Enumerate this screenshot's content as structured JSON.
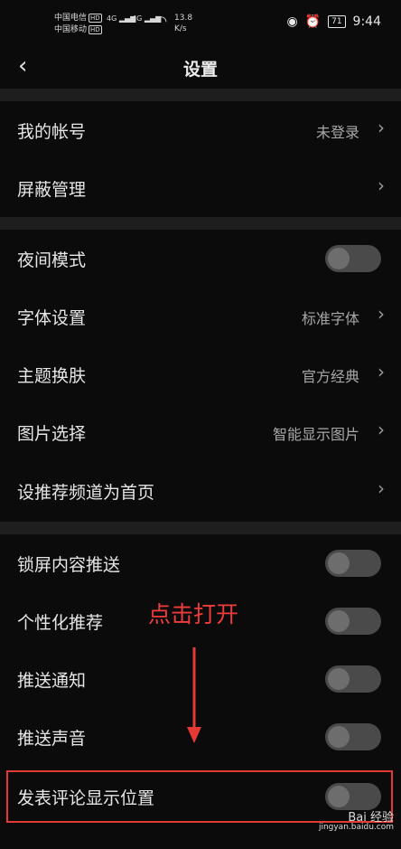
{
  "status": {
    "carrier1": "中国电信",
    "carrier2": "中国移动",
    "hd_badge": "HD",
    "net1": "4G",
    "net2": "4G",
    "speed_value": "13.8",
    "speed_unit": "K/s",
    "battery": "71",
    "time": "9:44"
  },
  "header": {
    "title": "设置"
  },
  "sections": [
    {
      "rows": [
        {
          "label": "我的帐号",
          "value": "未登录",
          "control": "chevron"
        },
        {
          "label": "屏蔽管理",
          "control": "chevron"
        }
      ]
    },
    {
      "rows": [
        {
          "label": "夜间模式",
          "control": "toggle",
          "toggle_on": false
        },
        {
          "label": "字体设置",
          "value": "标准字体",
          "control": "chevron"
        },
        {
          "label": "主题换肤",
          "value": "官方经典",
          "control": "chevron"
        },
        {
          "label": "图片选择",
          "value": "智能显示图片",
          "control": "chevron"
        },
        {
          "label": "设推荐频道为首页",
          "control": "chevron"
        }
      ]
    },
    {
      "rows": [
        {
          "label": "锁屏内容推送",
          "control": "toggle",
          "toggle_on": false
        },
        {
          "label": "个性化推荐",
          "control": "toggle",
          "toggle_on": false
        },
        {
          "label": "推送通知",
          "control": "toggle",
          "toggle_on": false
        },
        {
          "label": "推送声音",
          "control": "toggle",
          "toggle_on": false
        },
        {
          "label": "发表评论显示位置",
          "control": "toggle",
          "toggle_on": false
        }
      ]
    }
  ],
  "annotation": {
    "text": "点击打开",
    "color": "#f03c3c"
  },
  "watermark": {
    "brand": "Bai 经验",
    "url": "jingyan.baidu.com"
  },
  "colors": {
    "background": "#0b0b0b",
    "divider": "#1e1e1e",
    "toggle_off": "#4a4a4a"
  }
}
